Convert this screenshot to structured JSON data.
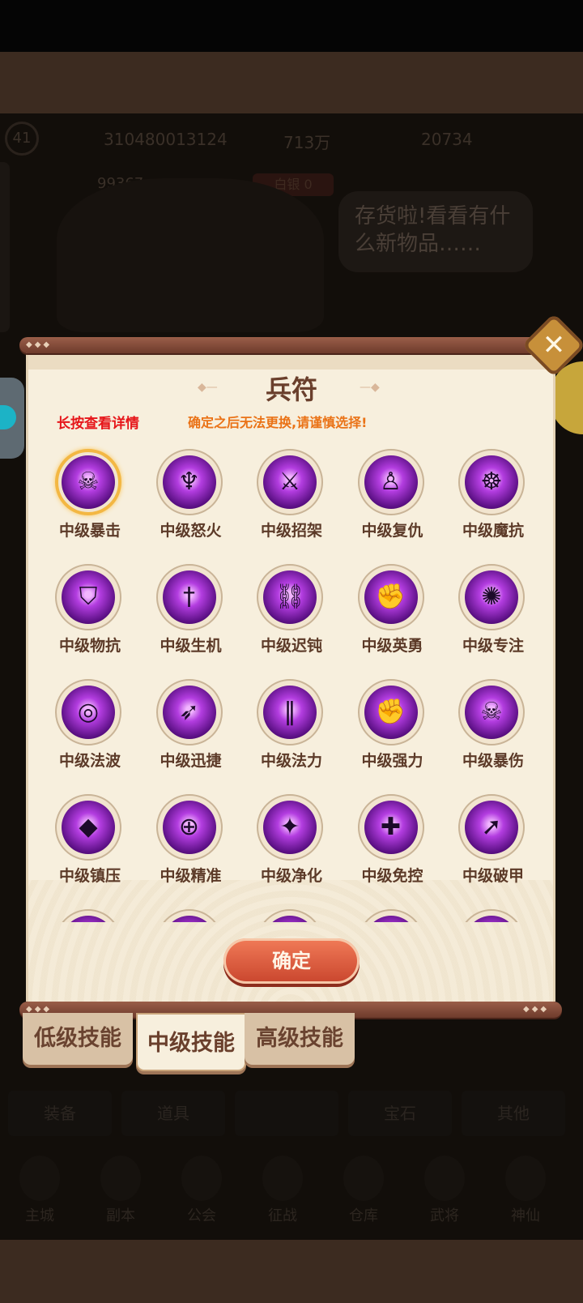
{
  "background": {
    "level": "41",
    "uid": "310480013124",
    "coin": "713万",
    "gold": "20734",
    "power": "99367",
    "tag": "白银 0",
    "npc_line": "存货啦!看看有什么新物品……",
    "bottom_tabs": [
      "装备",
      "道具",
      "",
      "宝石",
      "其他"
    ],
    "bottom_icons": [
      "主城",
      "副本",
      "公会",
      "征战",
      "仓库",
      "武将",
      "神仙"
    ]
  },
  "modal": {
    "title": "兵符",
    "hint_long_press": "长按查看详情",
    "hint_warning": "确定之后无法更换,请谨慎选择!",
    "confirm_label": "确定",
    "close_icon": "close-icon",
    "skills": [
      {
        "label": "中级暴击",
        "icon": "demon-beast-icon",
        "selected": true
      },
      {
        "label": "中级怒火",
        "icon": "flame-demon-icon",
        "selected": false
      },
      {
        "label": "中级招架",
        "icon": "parry-warrior-icon",
        "selected": false
      },
      {
        "label": "中级复仇",
        "icon": "vengeful-figure-icon",
        "selected": false
      },
      {
        "label": "中级魔抗",
        "icon": "meditating-mage-icon",
        "selected": false
      },
      {
        "label": "中级物抗",
        "icon": "shield-icon",
        "selected": false
      },
      {
        "label": "中级生机",
        "icon": "blade-icon",
        "selected": false
      },
      {
        "label": "中级迟钝",
        "icon": "chained-figure-icon",
        "selected": false
      },
      {
        "label": "中级英勇",
        "icon": "fist-icon",
        "selected": false
      },
      {
        "label": "中级专注",
        "icon": "vortex-focus-icon",
        "selected": false
      },
      {
        "label": "中级法波",
        "icon": "swirl-wave-icon",
        "selected": false
      },
      {
        "label": "中级迅捷",
        "icon": "swift-boot-icon",
        "selected": false
      },
      {
        "label": "中级法力",
        "icon": "mana-beam-icon",
        "selected": false
      },
      {
        "label": "中级强力",
        "icon": "strong-arm-icon",
        "selected": false
      },
      {
        "label": "中级暴伤",
        "icon": "flaming-skull-icon",
        "selected": false
      },
      {
        "label": "中级镇压",
        "icon": "crystal-prison-icon",
        "selected": false
      },
      {
        "label": "中级精准",
        "icon": "target-arrow-icon",
        "selected": false
      },
      {
        "label": "中级净化",
        "icon": "dancing-figure-icon",
        "selected": false
      },
      {
        "label": "中级免控",
        "icon": "shield-cross-icon",
        "selected": false
      },
      {
        "label": "中级破甲",
        "icon": "spear-strike-icon",
        "selected": false
      },
      {
        "label": "",
        "icon": "partial-orb-icon",
        "selected": false
      },
      {
        "label": "",
        "icon": "partial-orb-icon",
        "selected": false
      },
      {
        "label": "",
        "icon": "partial-orb-icon",
        "selected": false
      },
      {
        "label": "",
        "icon": "partial-orb-icon",
        "selected": false
      },
      {
        "label": "",
        "icon": "partial-orb-icon",
        "selected": false
      }
    ],
    "tabs": [
      {
        "label": "低级技能",
        "active": false
      },
      {
        "label": "中级技能",
        "active": true
      },
      {
        "label": "高级技能",
        "active": false
      }
    ]
  },
  "colors": {
    "accent_orb": "#b33de0",
    "title": "#6a3f2c",
    "hint_red": "#e6161a",
    "hint_orange": "#ea7216",
    "confirm": "#d8553a"
  }
}
